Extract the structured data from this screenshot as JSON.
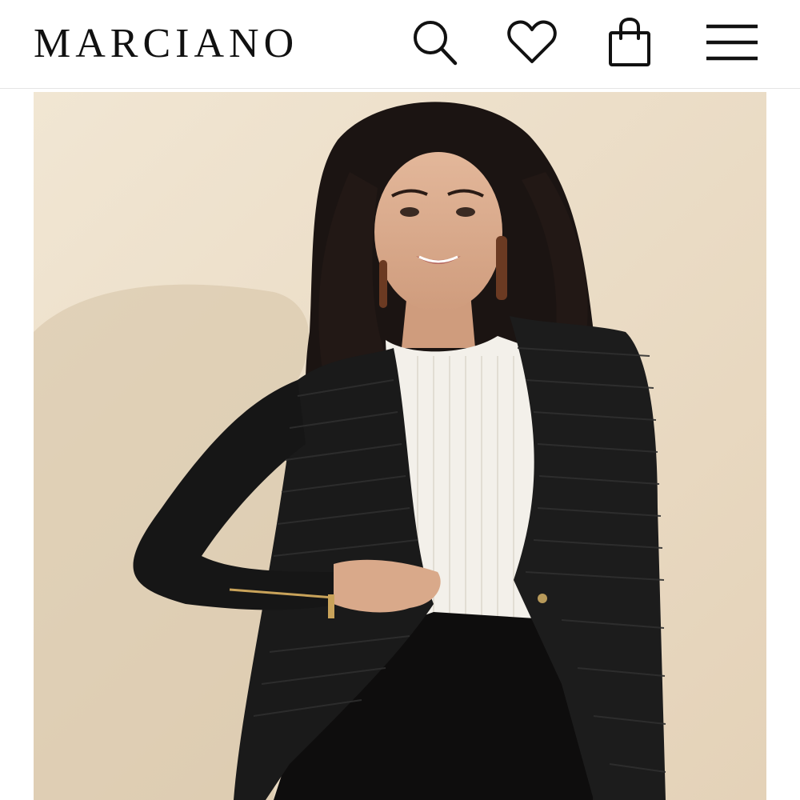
{
  "header": {
    "brand": "MARCIANO",
    "icons": {
      "search": "search-icon",
      "wishlist": "heart-icon",
      "bag": "shopping-bag-icon",
      "menu": "hamburger-menu-icon"
    }
  },
  "hero": {
    "image": "product-model-photo",
    "description_colors": {
      "background": "#eadbc4",
      "jacket": "#1a1a1a",
      "top": "#f3f0ea",
      "hair": "#1b1412"
    }
  }
}
